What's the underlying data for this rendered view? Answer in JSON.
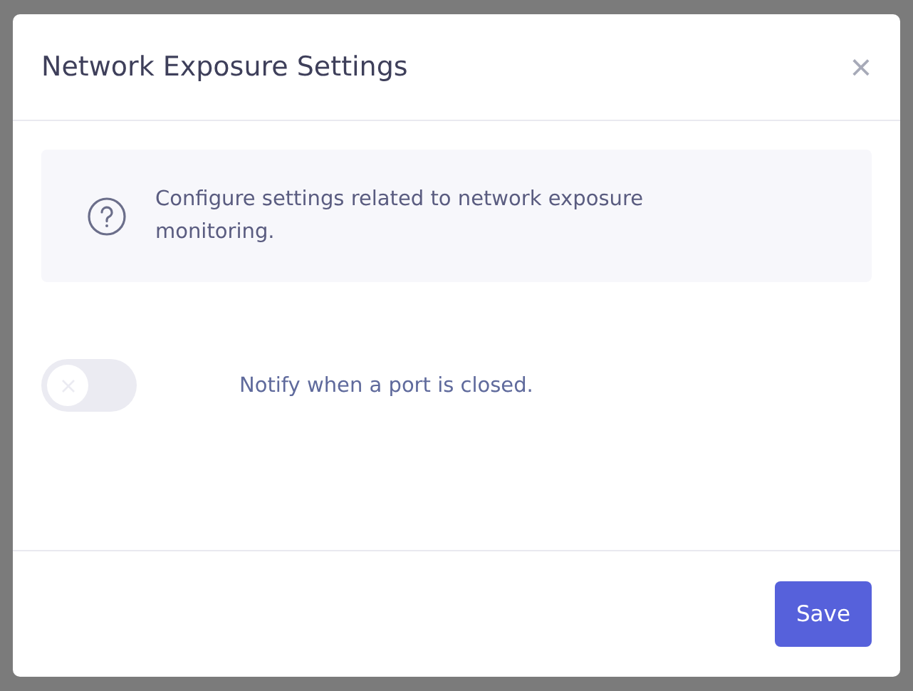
{
  "dialog": {
    "title": "Network Exposure Settings",
    "close_label": "×",
    "info": {
      "text": "Configure settings related to network exposure monitoring."
    },
    "settings": [
      {
        "kind": "toggle",
        "label": "Notify when a port is closed.",
        "on": false
      }
    ],
    "buttons": [
      "Save"
    ]
  }
}
